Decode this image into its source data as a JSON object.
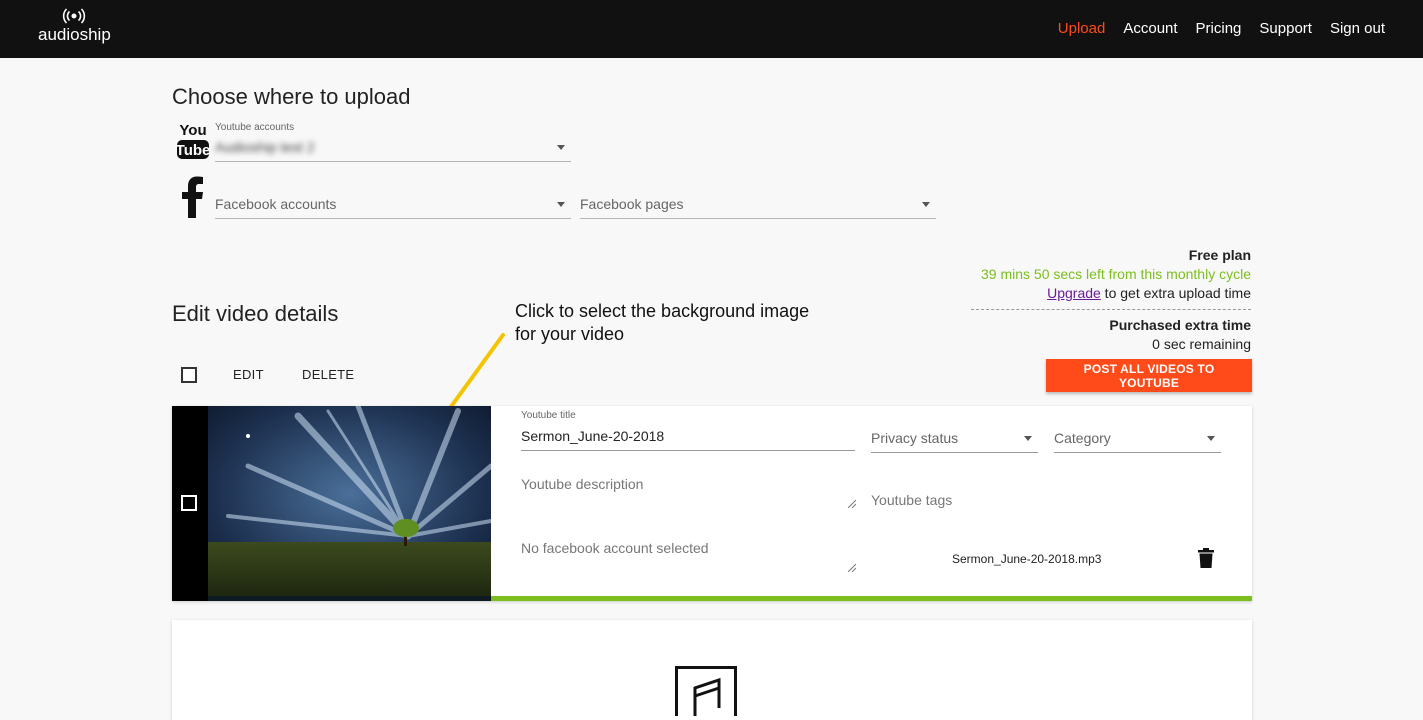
{
  "header": {
    "logo_text": "audioship",
    "nav": [
      "Upload",
      "Account",
      "Pricing",
      "Support",
      "Sign out"
    ],
    "active_color": "#ff4a1a"
  },
  "upload": {
    "title": "Choose where to upload",
    "youtube": {
      "label": "Youtube accounts",
      "value": "Audioship test 2",
      "icon": "youtube-logo-icon"
    },
    "facebook": {
      "accounts_placeholder": "Facebook accounts",
      "pages_placeholder": "Facebook pages",
      "icon": "facebook-logo-icon"
    }
  },
  "plan": {
    "name": "Free plan",
    "time_left": "39 mins 50 secs left from this monthly cycle",
    "upgrade_link": "Upgrade",
    "upgrade_suffix": " to get extra upload time",
    "extra_title": "Purchased extra time",
    "extra_remaining": "0 sec remaining",
    "time_left_color": "#7cbe1e"
  },
  "edit": {
    "title": "Edit video details",
    "edit_label": "EDIT",
    "delete_label": "DELETE",
    "post_button": "POST ALL VIDEOS TO YOUTUBE",
    "post_button_color": "#ff4a1a"
  },
  "annotation": {
    "line1": "Click to select the background image",
    "line2": "for your video",
    "arrow_color": "#f5c400"
  },
  "video": {
    "youtube_title_label": "Youtube title",
    "youtube_title_value": "Sermon_June-20-2018",
    "privacy_placeholder": "Privacy status",
    "category_placeholder": "Category",
    "description_placeholder": "Youtube description",
    "tags_placeholder": "Youtube tags",
    "facebook_placeholder": "No facebook account selected",
    "filename": "Sermon_June-20-2018.mp3",
    "progress_color": "#7cbe1e"
  }
}
